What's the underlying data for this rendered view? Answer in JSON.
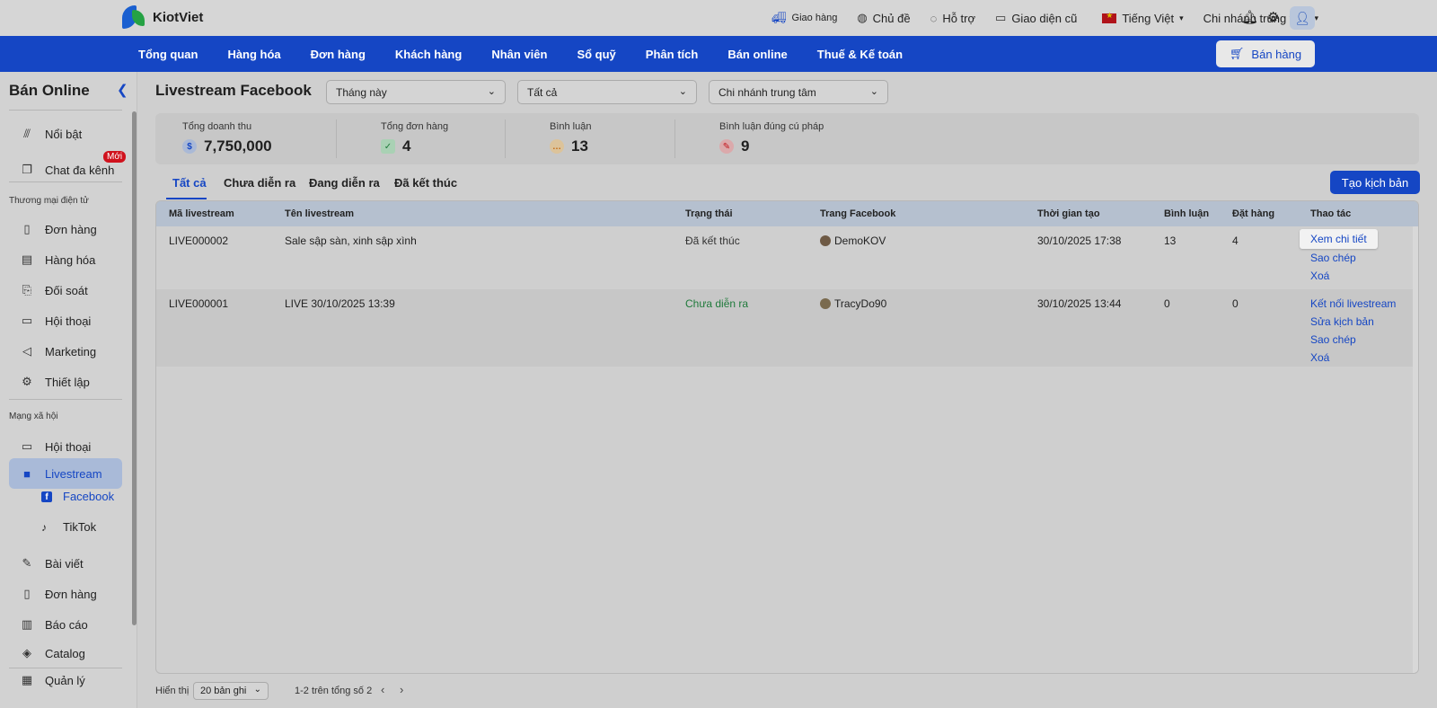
{
  "app": {
    "brand": "KiotViet"
  },
  "topbar": {
    "delivery": "Giao hàng",
    "theme": "Chủ đề",
    "support": "Hỗ trợ",
    "old_ui": "Giao diện cũ",
    "language": "Tiếng Việt",
    "branch": "Chi nhánh trung tâm"
  },
  "nav": {
    "items": [
      "Tổng quan",
      "Hàng hóa",
      "Đơn hàng",
      "Khách hàng",
      "Nhân viên",
      "Sổ quỹ",
      "Phân tích",
      "Bán online",
      "Thuế & Kế toán"
    ],
    "sell_button": "Bán hàng"
  },
  "sidebar": {
    "title": "Bán Online",
    "items": {
      "featured": "Nổi bật",
      "multichat": "Chat đa kênh",
      "badge_new": "Mới",
      "section_ecom": "Thương mại điện tử",
      "orders": "Đơn hàng",
      "products": "Hàng hóa",
      "reconcile": "Đối soát",
      "conversations": "Hội thoại",
      "marketing": "Marketing",
      "settings": "Thiết lập",
      "section_social": "Mạng xã hội",
      "social_conversations": "Hội thoại",
      "livestream": "Livestream",
      "facebook": "Facebook",
      "tiktok": "TikTok",
      "posts": "Bài viết",
      "social_orders": "Đơn hàng",
      "reports": "Báo cáo",
      "catalog": "Catalog",
      "manage": "Quản lý"
    }
  },
  "main": {
    "title": "Livestream Facebook",
    "filters": {
      "period": "Tháng này",
      "status": "Tất cả",
      "branch": "Chi nhánh trung tâm"
    },
    "stats": {
      "revenue_label": "Tổng doanh thu",
      "revenue_value": "7,750,000",
      "orders_label": "Tổng đơn hàng",
      "orders_value": "4",
      "comments_label": "Bình luận",
      "comments_value": "13",
      "syntax_label": "Bình luận đúng cú pháp",
      "syntax_value": "9"
    },
    "tabs": [
      "Tất cả",
      "Chưa diễn ra",
      "Đang diễn ra",
      "Đã kết thúc"
    ],
    "create_button": "Tạo kịch bản",
    "table": {
      "headers": [
        "Mã livestream",
        "Tên livestream",
        "Trạng thái",
        "Trang Facebook",
        "Thời gian tạo",
        "Bình luận",
        "Đặt hàng",
        "Thao tác"
      ],
      "rows": [
        {
          "code": "LIVE000002",
          "name": "Sale sập sàn, xinh sập xình",
          "status": "Đã kết thúc",
          "page": "DemoKOV",
          "created": "30/10/2025 17:38",
          "comments": "13",
          "orders": "4",
          "actions": [
            "Xem chi tiết",
            "Sao chép",
            "Xoá"
          ]
        },
        {
          "code": "LIVE000001",
          "name": "LIVE 30/10/2025 13:39",
          "status": "Chưa diễn ra",
          "page": "TracyDo90",
          "created": "30/10/2025 13:44",
          "comments": "0",
          "orders": "0",
          "actions": [
            "Kết nối livestream",
            "Sửa kịch bản",
            "Sao chép",
            "Xoá"
          ]
        }
      ]
    },
    "footer": {
      "show_label": "Hiển thị",
      "page_size": "20 bản ghi",
      "range": "1-2 trên tổng số 2"
    }
  },
  "colors": {
    "primary": "#1546c4",
    "status_pending": "#1f7a3b",
    "badge": "#d0121d"
  }
}
